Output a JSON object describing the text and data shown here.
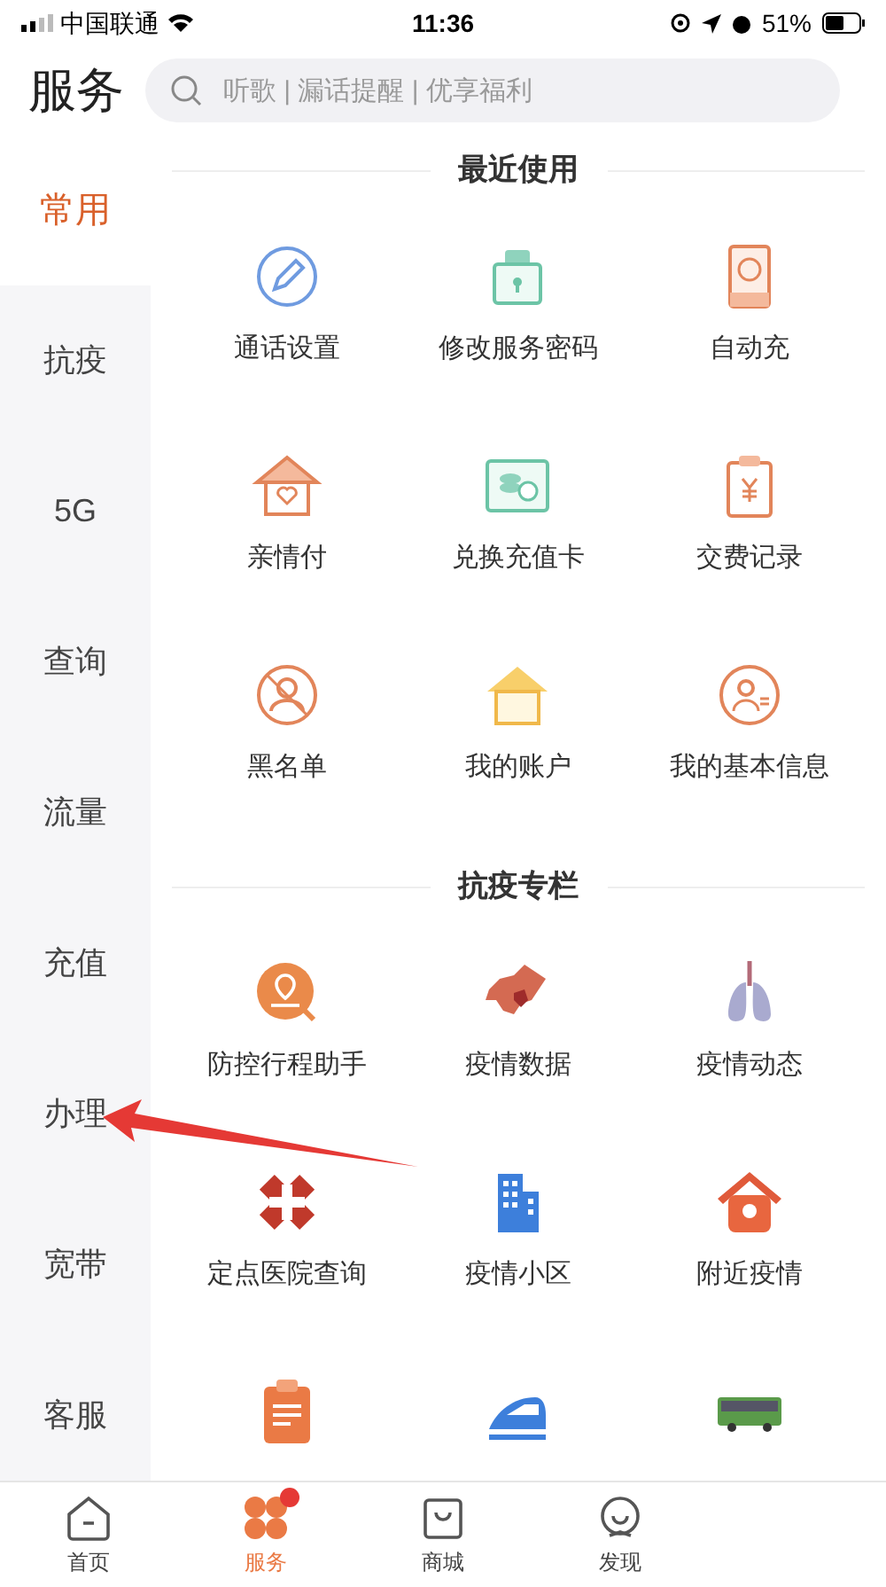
{
  "status_bar": {
    "carrier": "中国联通",
    "time": "11:36",
    "battery": "51%"
  },
  "header": {
    "title": "服务",
    "search": {
      "placeholder": "听歌 | 漏话提醒 | 优享福利"
    }
  },
  "sidebar": {
    "items": [
      {
        "label": "常用",
        "selected": true
      },
      {
        "label": "抗疫",
        "selected": false
      },
      {
        "label": "5G",
        "selected": false
      },
      {
        "label": "查询",
        "selected": false
      },
      {
        "label": "流量",
        "selected": false
      },
      {
        "label": "充值",
        "selected": false
      },
      {
        "label": "办理",
        "selected": false
      },
      {
        "label": "宽带",
        "selected": false
      },
      {
        "label": "客服",
        "selected": false
      }
    ]
  },
  "sections": [
    {
      "title": "最近使用",
      "items": [
        {
          "kind": "labeled",
          "label": "通话设置"
        },
        {
          "kind": "labeled",
          "label": "修改服务密码"
        },
        {
          "kind": "labeled",
          "label": "自动充"
        },
        {
          "kind": "labeled",
          "label": "亲情付"
        },
        {
          "kind": "labeled",
          "label": "兑换充值卡"
        },
        {
          "kind": "labeled",
          "label": "交费记录"
        },
        {
          "kind": "labeled",
          "label": "黑名单"
        },
        {
          "kind": "labeled",
          "label": "我的账户"
        },
        {
          "kind": "labeled",
          "label": "我的基本信息"
        }
      ]
    },
    {
      "title": "抗疫专栏",
      "items": [
        {
          "kind": "labeled",
          "label": "防控行程助手"
        },
        {
          "kind": "labeled",
          "label": "疫情数据"
        },
        {
          "kind": "labeled",
          "label": "疫情动态"
        },
        {
          "kind": "labeled",
          "label": "定点医院查询"
        },
        {
          "kind": "labeled",
          "label": "疫情小区"
        },
        {
          "kind": "labeled",
          "label": "附近疫情"
        },
        {
          "kind": "icon_only"
        },
        {
          "kind": "icon_only"
        },
        {
          "kind": "icon_only"
        }
      ]
    }
  ],
  "tab_bar": {
    "items": [
      {
        "label": "首页",
        "selected": false,
        "badge": false
      },
      {
        "label": "服务",
        "selected": true,
        "badge": true
      },
      {
        "label": "商城",
        "selected": false,
        "badge": false
      },
      {
        "label": "发现",
        "selected": false,
        "badge": false
      }
    ]
  }
}
